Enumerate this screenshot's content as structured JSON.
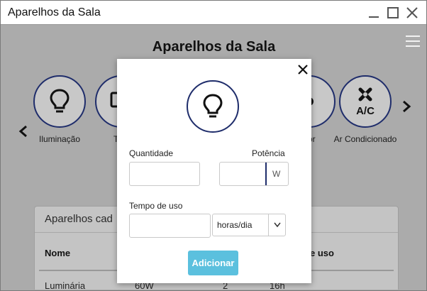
{
  "window": {
    "title": "Aparelhos da Sala"
  },
  "app": {
    "title": "Aparelhos da Sala",
    "devices": [
      {
        "label": "Iluminação",
        "icon": "lightbulb-icon"
      },
      {
        "label": "Tele",
        "icon": "monitor-icon"
      },
      {
        "label": "dor",
        "icon": "fan-icon"
      },
      {
        "label": "Ar Condicionado",
        "icon": "air-conditioner-icon"
      }
    ],
    "card": {
      "title": "Aparelhos cad",
      "columns": [
        "Nome",
        "e uso"
      ],
      "rows": [
        {
          "nome": "Luminária",
          "potencia": "60W",
          "quantidade": "2",
          "tempo": "16h"
        }
      ]
    }
  },
  "modal": {
    "icon": "lightbulb-icon",
    "quantidade_label": "Quantidade",
    "quantidade_value": "",
    "potencia_label": "Potência",
    "potencia_value": "",
    "potencia_unit": "W",
    "tempo_label": "Tempo de uso",
    "tempo_value": "",
    "tempo_unit_selected": "horas/dia",
    "submit_label": "Adicionar"
  },
  "colors": {
    "accent_navy": "#1f2d6b",
    "button": "#5bc0de",
    "overlay": "#ababab"
  }
}
